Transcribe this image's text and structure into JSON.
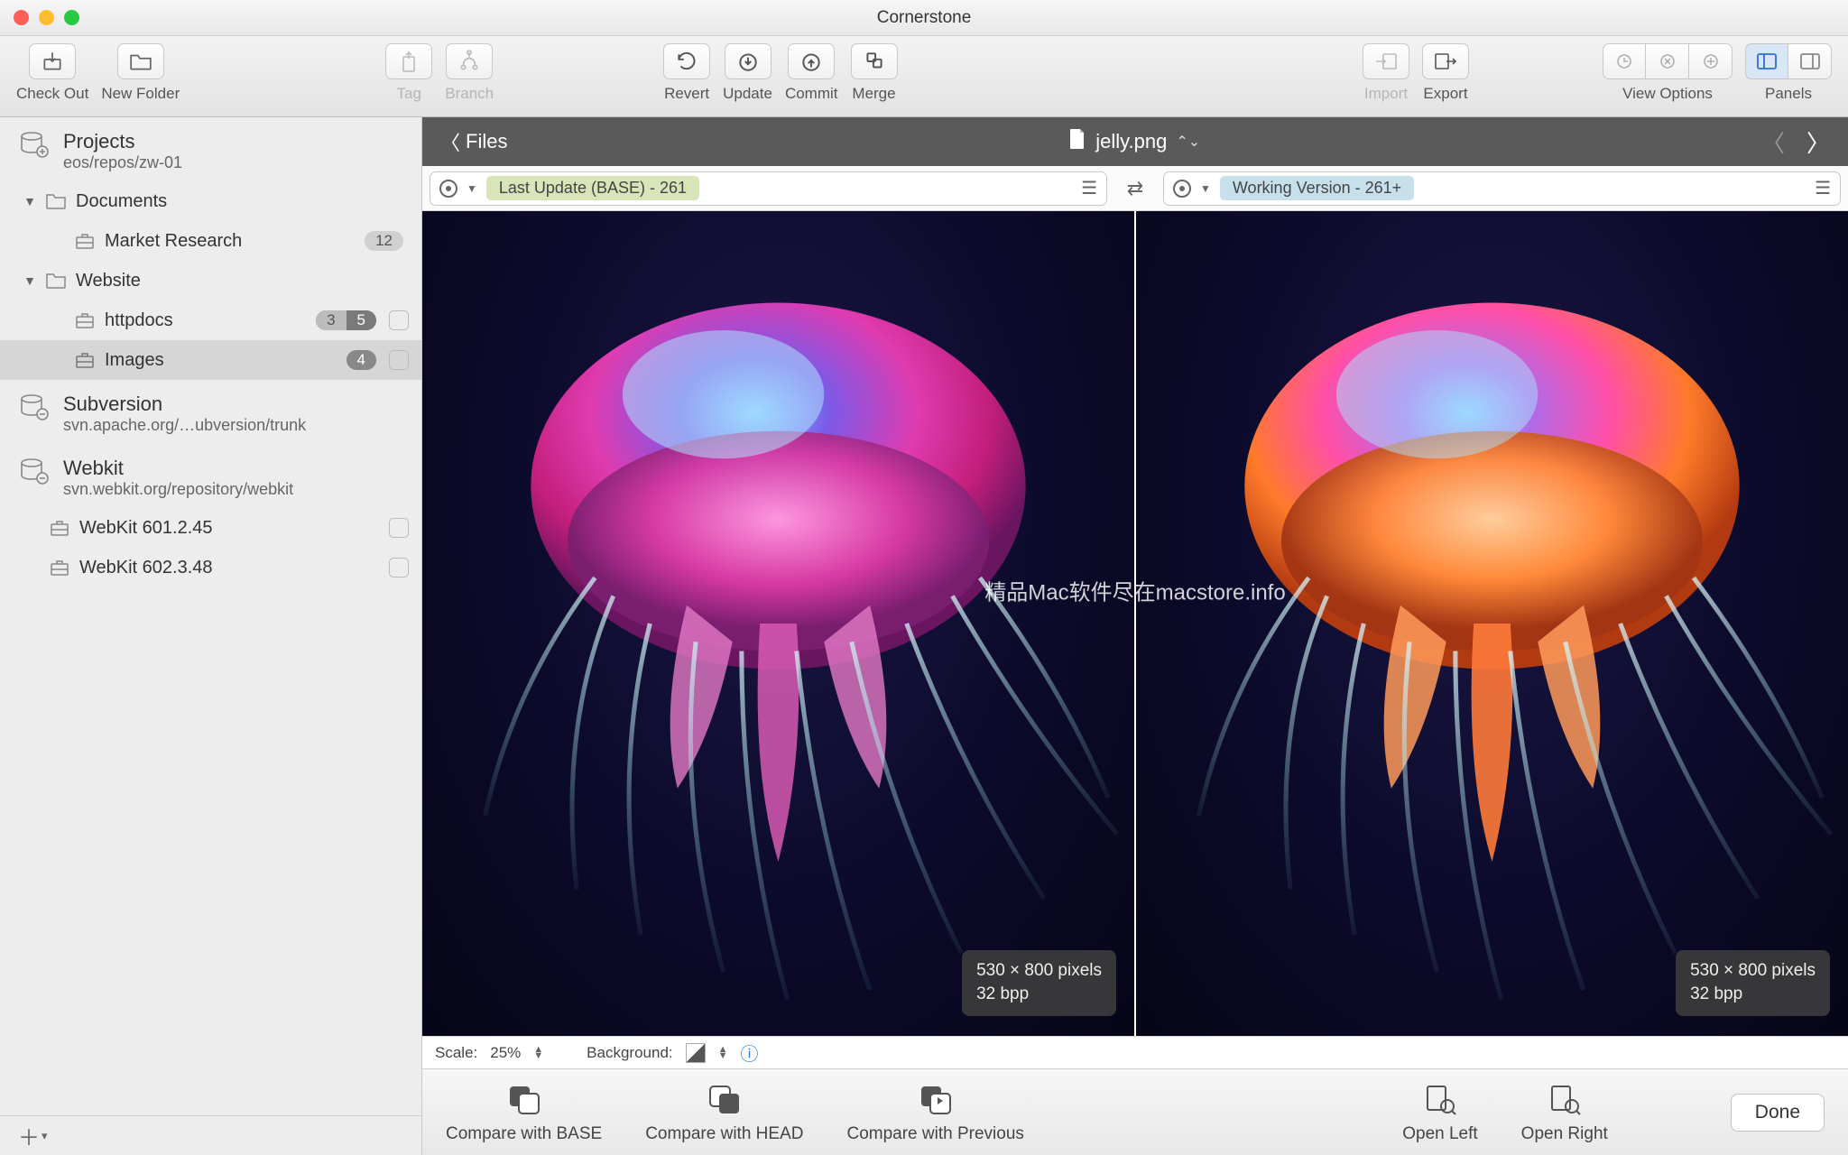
{
  "window": {
    "title": "Cornerstone"
  },
  "toolbar": {
    "checkout": "Check Out",
    "newfolder": "New Folder",
    "tag": "Tag",
    "branch": "Branch",
    "revert": "Revert",
    "update": "Update",
    "commit": "Commit",
    "merge": "Merge",
    "import": "Import",
    "export": "Export",
    "viewoptions": "View Options",
    "panels": "Panels"
  },
  "sidebar": {
    "projects": {
      "title": "Projects",
      "path": "eos/repos/zw-01"
    },
    "documents": "Documents",
    "market": {
      "label": "Market Research",
      "badge": "12"
    },
    "website": "Website",
    "httpdocs": {
      "label": "httpdocs",
      "badge_a": "3",
      "badge_b": "5"
    },
    "images": {
      "label": "Images",
      "badge": "4"
    },
    "subversion": {
      "title": "Subversion",
      "path": "svn.apache.org/…ubversion/trunk"
    },
    "webkit": {
      "title": "Webkit",
      "path": "svn.webkit.org/repository/webkit"
    },
    "wc": [
      {
        "label": "WebKit 601.2.45"
      },
      {
        "label": "WebKit 602.3.48"
      }
    ]
  },
  "darkbar": {
    "files": "Files",
    "filename": "jelly.png"
  },
  "versions": {
    "left": "Last Update (BASE) - 261",
    "right": "Working Version - 261+"
  },
  "imageinfo": {
    "dims": "530 × 800 pixels",
    "bpp": "32 bpp"
  },
  "watermark": "精品Mac软件尽在macstore.info",
  "footer": {
    "scale_label": "Scale:",
    "scale_value": "25%",
    "bg_label": "Background:"
  },
  "bottom": {
    "cmpbase": "Compare with BASE",
    "cmphead": "Compare with HEAD",
    "cmpprev": "Compare with Previous",
    "openleft": "Open Left",
    "openright": "Open Right",
    "done": "Done"
  }
}
